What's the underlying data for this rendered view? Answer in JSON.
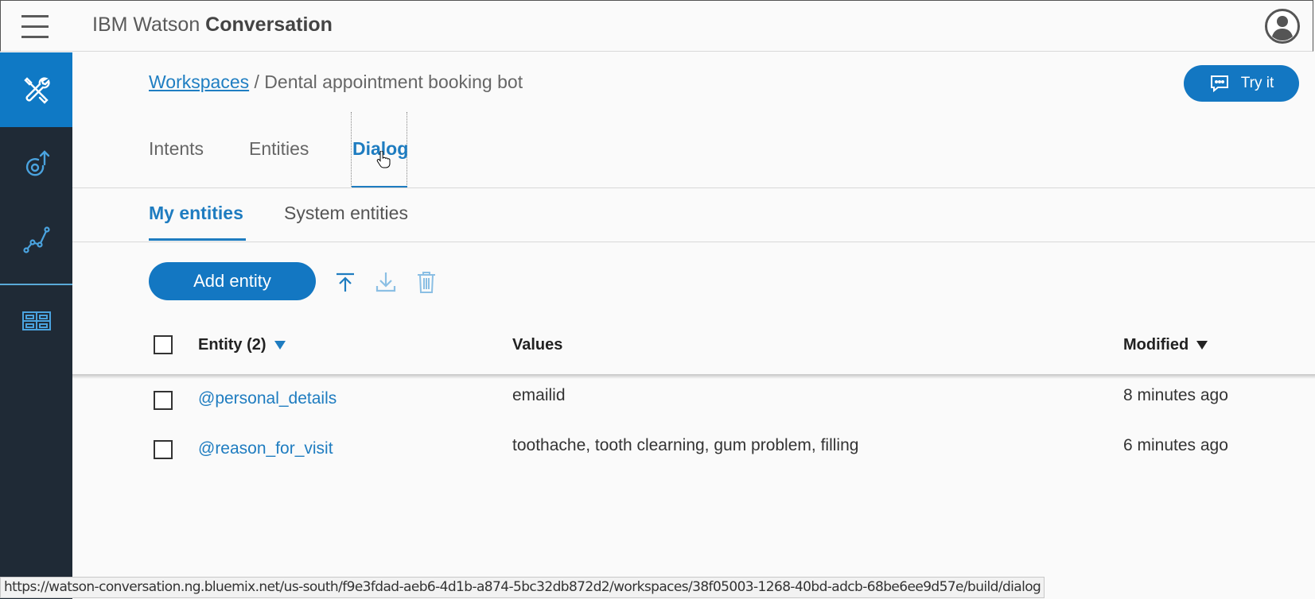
{
  "app": {
    "title_prefix": "IBM Watson",
    "title_bold": "Conversation"
  },
  "sidebar": {
    "items": [
      {
        "icon": "tools-icon",
        "active": true
      },
      {
        "icon": "deploy-icon",
        "active": false
      },
      {
        "icon": "analytics-icon",
        "active": false
      },
      {
        "icon": "workspaces-icon",
        "active": false
      }
    ]
  },
  "breadcrumb": {
    "link": "Workspaces",
    "separator": " / ",
    "current": "Dental appointment booking bot"
  },
  "try_button": {
    "label": "Try it"
  },
  "tabs": [
    {
      "label": "Intents",
      "active": false
    },
    {
      "label": "Entities",
      "active": false
    },
    {
      "label": "Dialog",
      "active": true
    }
  ],
  "subtabs": [
    {
      "label": "My entities",
      "active": true
    },
    {
      "label": "System entities",
      "active": false
    }
  ],
  "toolbar": {
    "add_label": "Add entity"
  },
  "table": {
    "headers": {
      "entity": "Entity (2)",
      "values": "Values",
      "modified": "Modified"
    },
    "rows": [
      {
        "entity": "@personal_details",
        "values": "emailid",
        "modified": "8 minutes ago"
      },
      {
        "entity": "@reason_for_visit",
        "values": "toothache, tooth clearning, gum problem, filling",
        "modified": "6 minutes ago"
      }
    ]
  },
  "status_bar": {
    "url": "https://watson-conversation.ng.bluemix.net/us-south/f9e3fdad-aeb6-4d1b-a874-5bc32db872d2/workspaces/38f05003-1268-40bd-adcb-68be6ee9d57e/build/dialog"
  },
  "colors": {
    "accent": "#1377c2",
    "sidebar_bg": "#1f2a36",
    "link": "#1e7cc0"
  }
}
